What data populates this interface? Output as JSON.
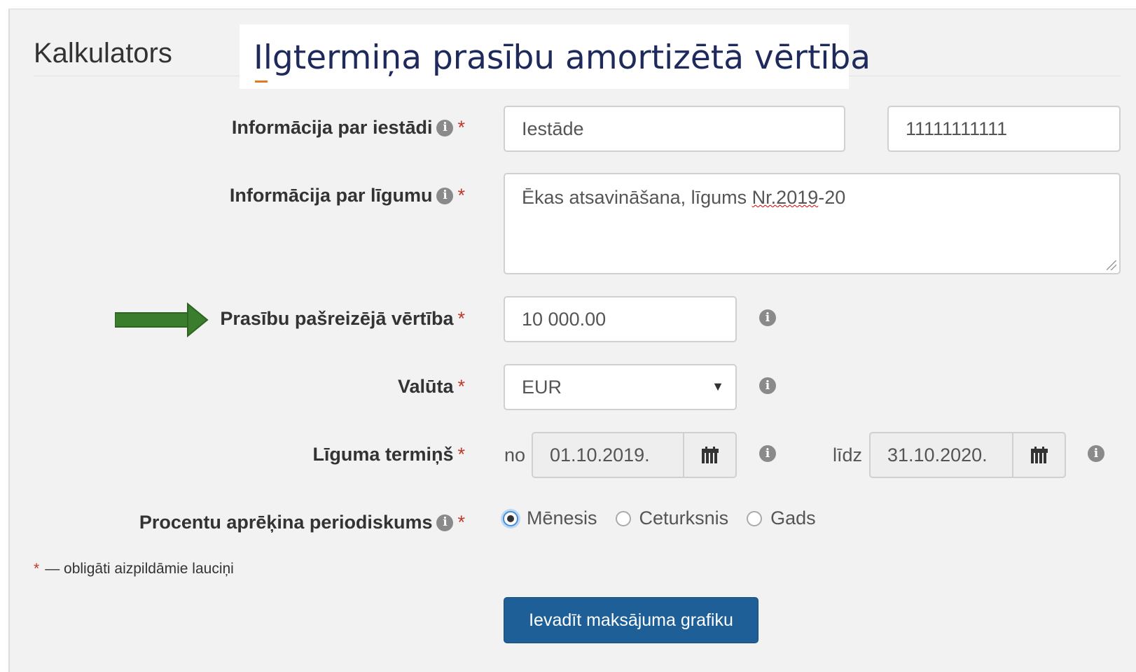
{
  "panel": {
    "title": "Kalkulators",
    "overlay_title": "Ilgtermiņa prasību amortizētā vērtība"
  },
  "form": {
    "institution": {
      "label": "Informācija par iestādi",
      "required_mark": "*",
      "name_value": "Iestāde",
      "reg_number_value": "11111111111"
    },
    "contract": {
      "label": "Informācija par līgumu",
      "required_mark": "*",
      "value_prefix": "Ēkas atsavināšana, līgums ",
      "value_misspelled": "Nr.2019",
      "value_suffix": "-20"
    },
    "present_value": {
      "label": "Prasību pašreizējā vērtība",
      "required_mark": "*",
      "value": "10 000.00"
    },
    "currency": {
      "label": "Valūta",
      "required_mark": "*",
      "selected": "EUR",
      "caret": "▼"
    },
    "term": {
      "label": "Līguma termiņš",
      "required_mark": "*",
      "from_label": "no",
      "from_value": "01.10.2019.",
      "to_label": "līdz",
      "to_value": "31.10.2020."
    },
    "periodicity": {
      "label": "Procentu aprēķina periodiskums",
      "required_mark": "*",
      "options": [
        "Mēnesis",
        "Ceturksnis",
        "Gads"
      ],
      "selected": "Mēnesis"
    },
    "footnote_mark": "*",
    "footnote": "— obligāti aizpildāmie lauciņi",
    "submit_label": "Ievadīt maksājuma grafiku"
  },
  "icons": {
    "info": "info-icon",
    "calendar": "calendar-icon",
    "annotation_arrow": "arrow-right-icon",
    "info_glyph": "i"
  },
  "colors": {
    "panel_bg": "#f2f2f2",
    "overlay_title": "#1f2a5c",
    "required": "#c0392b",
    "button_bg": "#1e5f98",
    "arrow": "#3a7d2c"
  }
}
